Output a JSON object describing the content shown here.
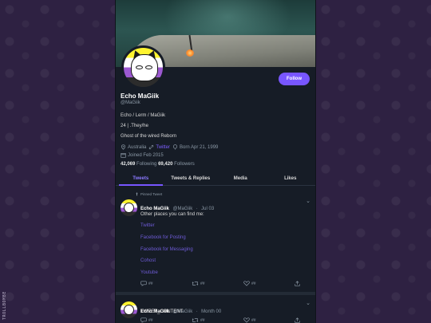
{
  "side_credit": "TROLLBOMBE",
  "profile": {
    "follow_label": "Follow",
    "name": "Echo MaGiik",
    "handle": "@MaGiik",
    "bio": [
      "Echo / Lerm / MaGiik",
      "24 | .They/he",
      "Ghost of the wired Reborn"
    ],
    "location": "Australia",
    "link_label": "Twitter",
    "birthday": "Born Apr 21, 1999",
    "joined": "Joined Feb 2015",
    "following_count": "42,069",
    "following_label": "Following",
    "followers_count": "69,420",
    "followers_label": "Followers"
  },
  "tabs": [
    "Tweets",
    "Tweets & Replies",
    "Media",
    "Likes"
  ],
  "tweets": [
    {
      "pinned_label": "Pinned Tweet",
      "name": "Echo MaGiik",
      "handle": "@MaGiik",
      "sep": "·",
      "date": "Jul 03",
      "text": "Other places you can find me:",
      "links": [
        "Twitter",
        "Facebook for Posting",
        "Facebook for Messaging",
        "Cohost",
        "Youtube"
      ],
      "reply_count": "##",
      "retweet_count": "##",
      "like_count": "##"
    },
    {
      "name": "Echo MaGiik",
      "handle": "@MaGiik",
      "sep": "·",
      "date": "Month 00",
      "text": "TWEET_CONTENT",
      "reply_count": "##",
      "retweet_count": "##",
      "like_count": "##"
    }
  ],
  "colors": {
    "accent": "#7856ff",
    "column_bg": "#161c26",
    "page_bg": "#2e2142"
  }
}
